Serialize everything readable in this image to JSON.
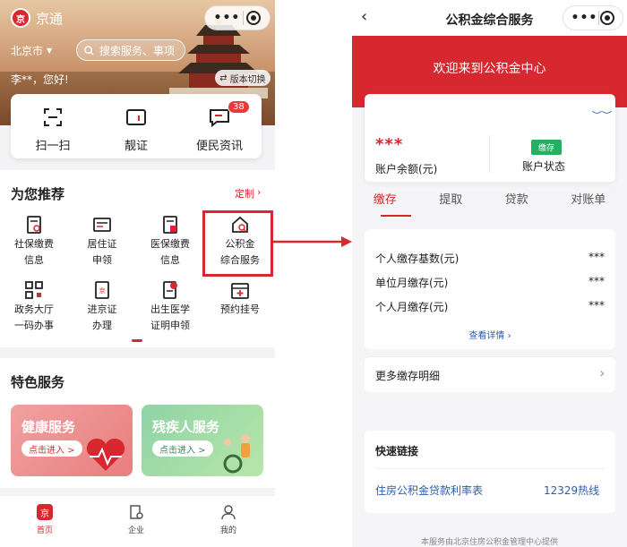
{
  "left": {
    "app_name": "京通",
    "logo_text": "京",
    "city": "北京市",
    "search_placeholder": "搜索服务、事项",
    "greeting": "李**，您好!",
    "version_switch": "版本切换",
    "quick_actions": [
      {
        "label": "扫一扫",
        "icon": "scan-icon"
      },
      {
        "label": "靓证",
        "icon": "card-icon"
      },
      {
        "label": "便民资讯",
        "icon": "message-icon",
        "badge": "38"
      }
    ],
    "recommend": {
      "title": "为您推荐",
      "customize": "定制",
      "items": [
        {
          "line1": "社保缴费",
          "line2": "信息",
          "icon": "social-insurance-icon"
        },
        {
          "line1": "居住证",
          "line2": "申领",
          "icon": "residence-permit-icon"
        },
        {
          "line1": "医保缴费",
          "line2": "信息",
          "icon": "medical-insurance-icon"
        },
        {
          "line1": "公积金",
          "line2": "综合服务",
          "icon": "housing-fund-icon"
        },
        {
          "line1": "政务大厅",
          "line2": "一码办事",
          "icon": "qr-code-icon"
        },
        {
          "line1": "进京证",
          "line2": "办理",
          "icon": "beijing-permit-icon"
        },
        {
          "line1": "出生医学",
          "line2": "证明申领",
          "icon": "birth-certificate-icon"
        },
        {
          "line1": "预约挂号",
          "line2": "",
          "icon": "appointment-icon"
        }
      ]
    },
    "featured": {
      "title": "特色服务",
      "banners": [
        {
          "title": "健康服务",
          "button": "点击进入 >"
        },
        {
          "title": "残疾人服务",
          "button": "点击进入 >"
        }
      ]
    },
    "tabbar": [
      {
        "label": "首页",
        "icon": "home-icon",
        "active": true
      },
      {
        "label": "企业",
        "icon": "enterprise-icon",
        "active": false
      },
      {
        "label": "我的",
        "icon": "profile-icon",
        "active": false
      }
    ]
  },
  "right": {
    "title": "公积金综合服务",
    "welcome": "欢迎来到公积金中心",
    "balance_value": "***",
    "balance_label": "账户余额(元)",
    "status_badge": "缴存",
    "status_label": "账户状态",
    "tabs": [
      "缴存",
      "提取",
      "贷款",
      "对账单"
    ],
    "active_tab": 0,
    "details": [
      {
        "label": "个人缴存基数(元)",
        "value": "***"
      },
      {
        "label": "单位月缴存(元)",
        "value": "***"
      },
      {
        "label": "个人月缴存(元)",
        "value": "***"
      }
    ],
    "view_details": "查看详情",
    "more_records": "更多缴存明细",
    "quick_links_title": "快速链接",
    "quick_link_left": "住房公积金贷款利率表",
    "quick_link_right": "12329热线",
    "footer": "本服务由北京住房公积金管理中心提供"
  },
  "colors": {
    "brand_red": "#d7282f",
    "link_blue": "#2a5db0",
    "status_green": "#27ae60"
  }
}
